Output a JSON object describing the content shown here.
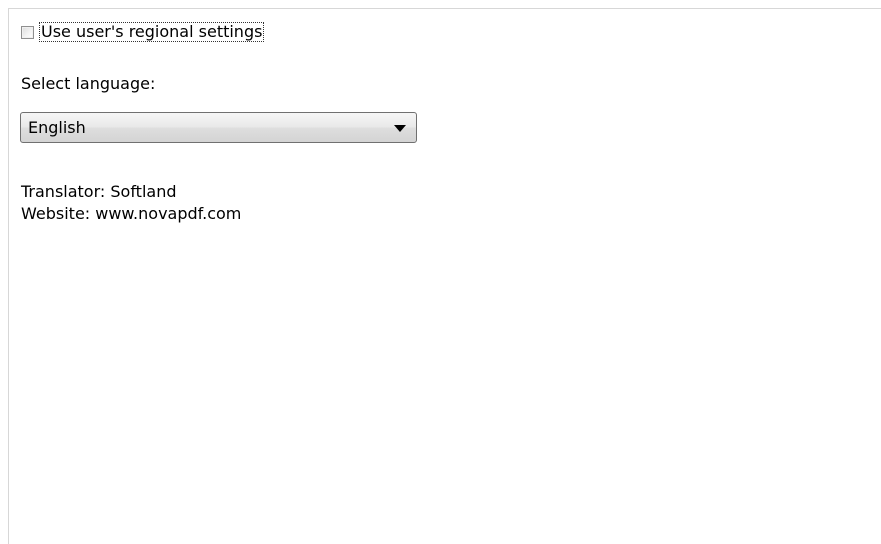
{
  "regional": {
    "checkbox_label": "Use user's regional settings",
    "checked": false
  },
  "language": {
    "label": "Select language:",
    "selected": "English"
  },
  "info": {
    "translator": "Translator: Softland",
    "website": "Website: www.novapdf.com"
  }
}
